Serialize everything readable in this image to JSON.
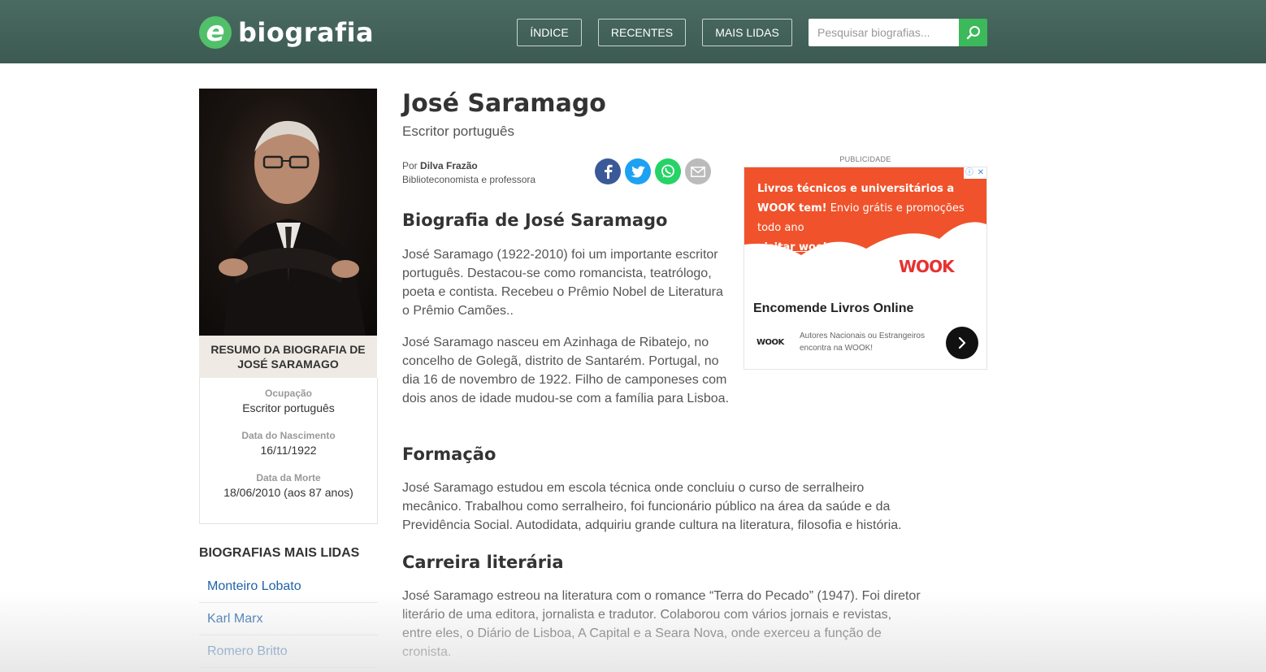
{
  "header": {
    "logo_letter": "e",
    "logo_text": "biografia",
    "nav": [
      {
        "label": "ÍNDICE"
      },
      {
        "label": "RECENTES"
      },
      {
        "label": "MAIS LIDAS"
      }
    ],
    "search_placeholder": "Pesquisar biografias..."
  },
  "sidebar": {
    "summary_title": "RESUMO DA BIOGRAFIA DE JOSÉ SARAMAGO",
    "facts": [
      {
        "label": "Ocupação",
        "value": "Escritor português"
      },
      {
        "label": "Data do Nascimento",
        "value": "16/11/1922"
      },
      {
        "label": "Data da Morte",
        "value": "18/06/2010 (aos 87 anos)"
      }
    ],
    "most_read_title": "BIOGRAFIAS MAIS LIDAS",
    "most_read": [
      "Monteiro Lobato",
      "Karl Marx",
      "Romero Britto"
    ]
  },
  "article": {
    "title": "José Saramago",
    "subtitle": "Escritor português",
    "author_prefix": "Por",
    "author": "Dilva Frazão",
    "author_role": "Biblioteconomista e professora",
    "sections": [
      {
        "heading": "Biografia de José Saramago"
      },
      {
        "heading": "Formação"
      },
      {
        "heading": "Carreira literária"
      }
    ],
    "paragraphs": [
      "José Saramago (1922-2010) foi um importante escritor português. Destacou-se como romancista, teatrólogo, poeta e contista. Recebeu o Prêmio Nobel de Literatura o Prêmio Camões..",
      "José Saramago nasceu em Azinhaga de Ribatejo, no concelho de Golegã, distrito de Santarém. Portugal, no dia 16 de novembro de 1922. Filho de camponeses com dois anos de idade mudou-se com a família para Lisboa.",
      "José Saramago estudou em escola técnica onde concluiu o curso de serralheiro mecânico. Trabalhou como serralheiro, foi funcionário público na área da saúde e da Previdência Social. Autodidata, adquiriu grande cultura na literatura, filosofia e história.",
      "José Saramago estreou na literatura com o romance “Terra do Pecado” (1947). Foi diretor literário de uma editora, jornalista e tradutor. Colaborou com vários jornais e revistas, entre eles, o Diário de Lisboa, A Capital e a Seara Nova, onde exerceu a função de cronista."
    ]
  },
  "ad": {
    "label": "PUBLICIDADE",
    "headline_bold": "Livros técnicos e universitários a WOOK tem!",
    "headline_rest": " Envio grátis e promoções todo ano",
    "link": "visitar wook.pt",
    "brand": "WOOK",
    "brand_small": "WOOK",
    "title": "Encomende Livros Online",
    "description": "Autores Nacionais ou Estrangeiros encontra na WOOK!"
  },
  "colors": {
    "header_bg": "#3c5a52",
    "logo_green": "#52c06a",
    "search_green": "#3cb95a",
    "link_blue": "#1f62a8",
    "facebook": "#3b5998",
    "twitter": "#1da1f2",
    "whatsapp": "#25d366",
    "email": "#bbbbbb",
    "ad_orange": "#f0522b"
  }
}
